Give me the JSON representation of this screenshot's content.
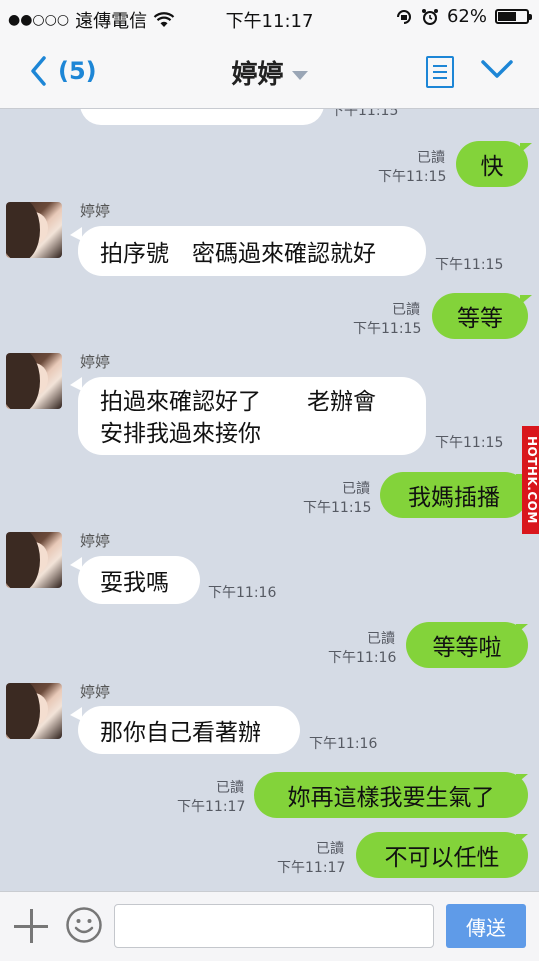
{
  "status": {
    "signal_dots": "●●○○○",
    "carrier": "遠傳電信",
    "time": "下午11:17",
    "battery_percent": "62%"
  },
  "nav": {
    "back_count": "(5)",
    "title": "婷婷"
  },
  "chat": {
    "partial_time": "下午11:15",
    "contact_name": "婷婷",
    "read_label": "已讀",
    "messages": [
      {
        "dir": "out",
        "text": "快",
        "time": "下午11:15",
        "read": true
      },
      {
        "dir": "in",
        "text": "拍序號　密碼過來確認就好",
        "time": "下午11:15"
      },
      {
        "dir": "out",
        "text": "等等",
        "time": "下午11:15",
        "read": true
      },
      {
        "dir": "in",
        "lines": [
          "拍過來確認好了　　老辦會",
          "安排我過來接你"
        ],
        "time": "下午11:15"
      },
      {
        "dir": "out",
        "text": "我媽插播",
        "time": "下午11:15",
        "read": true
      },
      {
        "dir": "in",
        "text": "耍我嗎",
        "time": "下午11:16"
      },
      {
        "dir": "out",
        "text": "等等啦",
        "time": "下午11:16",
        "read": true
      },
      {
        "dir": "in",
        "text": "那你自己看著辦",
        "time": "下午11:16"
      },
      {
        "dir": "out",
        "text": "妳再這樣我要生氣了",
        "time": "下午11:17",
        "read": true
      },
      {
        "dir": "out",
        "text": "不可以任性",
        "time": "下午11:17",
        "read": true
      }
    ]
  },
  "watermark": "HOTHK.COM",
  "input": {
    "value": "",
    "placeholder": "",
    "send_label": "傳送"
  }
}
